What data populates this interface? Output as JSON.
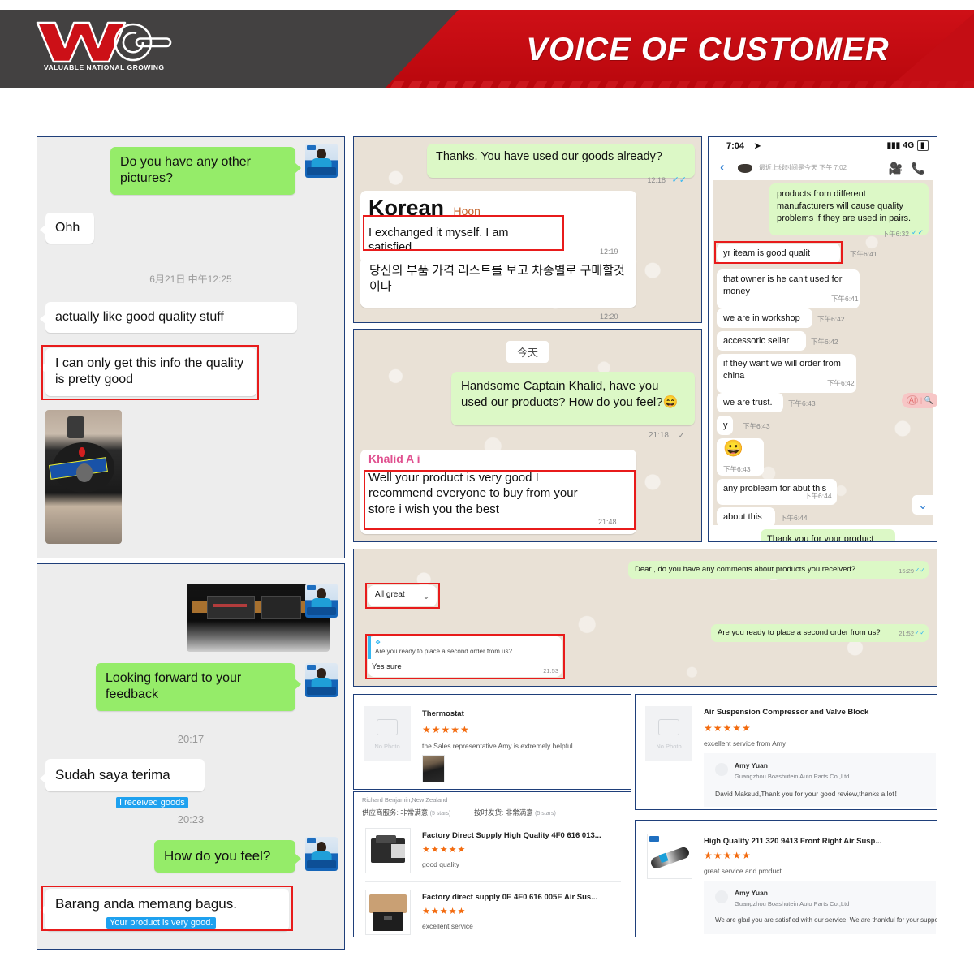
{
  "header": {
    "title": "VOICE OF CUSTOMER",
    "logo_text": "WNG",
    "logo_tagline": "VALUABLE  NATIONAL  GROWING"
  },
  "panel_wechat_1": {
    "messages": [
      {
        "side": "out",
        "text": "Do you have any other pictures?"
      },
      {
        "side": "in",
        "text": "Ohh"
      },
      {
        "side": "in",
        "text": "actually like good quality stuff"
      },
      {
        "side": "in",
        "text": "I can only get this info the quality is pretty good",
        "highlighted": true
      }
    ],
    "timestamp": "6月21日 中午12:25"
  },
  "panel_whatsapp_korean": {
    "messages": [
      {
        "side": "out",
        "text": "Thanks. You have used our goods already?",
        "time": "12:18",
        "ticks": "✓✓"
      },
      {
        "side": "in",
        "sender_big": "Korean",
        "sender_small": "Hoon",
        "text": "I exchanged it myself. I am satisfied",
        "time": "12:19",
        "highlighted": true
      },
      {
        "side": "in",
        "text": "당신의 부품 가격 리스트를 보고 차종별로 구매할것이다",
        "time": "12:20"
      }
    ]
  },
  "panel_whatsapp_khalid": {
    "date_chip": "今天",
    "messages": [
      {
        "side": "out",
        "text": "Handsome Captain Khalid, have you used our products? How do you feel?😄",
        "time": "21:18",
        "ticks": "✓"
      },
      {
        "side": "in",
        "sender": "Khalid A        i",
        "text": "Well your product is very good I recommend everyone to buy from your store i wish you the best",
        "time": "21:48",
        "highlighted": true
      }
    ]
  },
  "panel_phone_wechat": {
    "status_time": "7:04",
    "status_network": "4G",
    "nav_subtitle": "最近上线时间是今天 下午 7:02",
    "messages": [
      {
        "side": "out",
        "text": "products from different manufacturers will cause quality problems if they are used in pairs.",
        "time": "下午6:32",
        "ticks": "✓✓"
      },
      {
        "side": "in",
        "text": "yr iteam is good qualit",
        "time": "下午6:41",
        "highlighted": true
      },
      {
        "side": "in",
        "text": "that owner is he can't used for money",
        "time": "下午6:41"
      },
      {
        "side": "in",
        "text": "we are in workshop",
        "time": "下午6:42"
      },
      {
        "side": "in",
        "text": "accessoric sellar",
        "time": "下午6:42"
      },
      {
        "side": "in",
        "text": "if they want we will order from china",
        "time": "下午6:42"
      },
      {
        "side": "in",
        "text": "we are trust.",
        "time": "下午6:43"
      },
      {
        "side": "in",
        "text": "y",
        "time": "下午6:43"
      },
      {
        "side": "in",
        "text": "😀",
        "time": "下午6:43",
        "is_emoji": true
      },
      {
        "side": "in",
        "text": "any probleam for abut this",
        "time": "下午6:44"
      },
      {
        "side": "in",
        "text": "about this",
        "time": "下午6:44"
      },
      {
        "side": "out",
        "text": "Thank you for your product"
      }
    ],
    "side_pill_ai": "AI",
    "side_pill_search": "🔍"
  },
  "panel_wechat_2": {
    "messages": [
      {
        "side": "out",
        "text": "Looking forward to your feedback"
      },
      {
        "side": "in",
        "text": "Sudah saya terima",
        "sub": "I received goods"
      },
      {
        "side": "out",
        "text": "How do you feel?"
      },
      {
        "side": "in",
        "text": "Barang anda memang bagus.",
        "sub": "Your product is very good.",
        "highlighted": true
      }
    ],
    "timestamps": [
      "20:17",
      "20:23"
    ]
  },
  "panel_wide_whatsapp": {
    "messages": [
      {
        "side": "out",
        "text": "Dear           , do you have any comments about products you received?",
        "time": "15:29",
        "ticks": "✓✓"
      },
      {
        "side": "in",
        "text": "All great",
        "highlighted": true,
        "has_chevron": true
      },
      {
        "side": "out",
        "text": "Are you ready to place a second order from us?",
        "time": "21:52",
        "ticks": "✓✓"
      },
      {
        "side": "in",
        "quote": "Are you ready to place a second order from us?",
        "text": "Yes sure",
        "time": "21:53",
        "highlighted": true
      }
    ]
  },
  "reviews_left": [
    {
      "title": "Thermostat",
      "stars": "★★★★★",
      "text": "the Sales representative Amy is extremely helpful.",
      "no_photo_label": "No Photo",
      "has_thumb": true
    }
  ],
  "reviews_left_list": {
    "reviewer": "Richard Benjamin,New Zealand",
    "metrics": [
      {
        "label": "供应商服务: 非常满意",
        "stars": "(5 stars)"
      },
      {
        "label": "按时发货: 非常满意",
        "stars": "(5 stars)"
      }
    ],
    "items": [
      {
        "title": "Factory Direct Supply High Quality 4F0 616 013...",
        "stars": "★★★★★",
        "text": "good quality"
      },
      {
        "title": "Factory direct supply 0E 4F0 616 005E Air Sus...",
        "stars": "★★★★★",
        "text": "excellent service"
      }
    ]
  },
  "reviews_right": [
    {
      "title": "Air Suspension Compressor and Valve Block",
      "stars": "★★★★★",
      "text": "excellent service from Amy",
      "no_photo_label": "No Photo",
      "reply_name": "Amy Yuan",
      "reply_company": "Guangzhou Boashutein Auto Parts Co.,Ltd",
      "reply_text": "David Maksud,Thank you for your good review,thanks a lot！"
    },
    {
      "title": "High Quality 211 320 9413 Front Right Air Susp...",
      "stars": "★★★★★",
      "text": "great service and product",
      "reply_name": "Amy Yuan",
      "reply_company": "Guangzhou Boashutein Auto Parts Co.,Ltd",
      "reply_text": "We are glad you are satisfied with our service.  We are thankful for your support."
    }
  ],
  "colors": {
    "brand_red": "#c40d14",
    "header_dark": "#434141",
    "panel_border": "#1f3f7a",
    "highlight_red": "#e81b1b",
    "wechat_green": "#95ec69",
    "whatsapp_green": "#dcf8c6",
    "star_orange": "#f36b0f",
    "sub_blue": "#1ea1ef"
  }
}
